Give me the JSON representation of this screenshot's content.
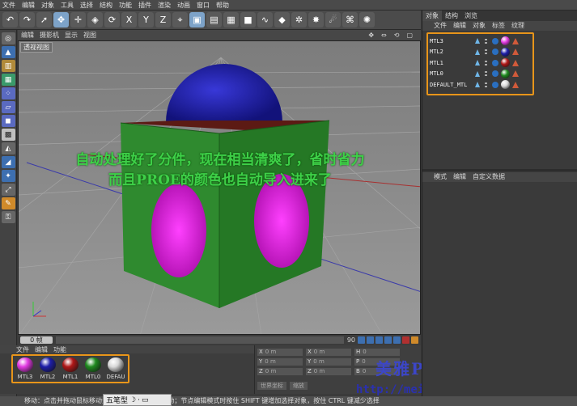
{
  "menubar": [
    "文件",
    "编辑",
    "对象",
    "工具",
    "选择",
    "结构",
    "功能",
    "插件",
    "渲染",
    "动画",
    "窗口",
    "帮助"
  ],
  "viewport": {
    "menu": [
      "编辑",
      "摄影机",
      "显示",
      "视图"
    ],
    "label": "透视视图",
    "caption_line1": "自动处理好了分件，现在相当清爽了，省时省力",
    "caption_line2": "而且PROE的颜色也自动导入进来了"
  },
  "timeline": {
    "frame_left": "0 帧",
    "frame_right": "90"
  },
  "materials": {
    "menu": [
      "文件",
      "编辑",
      "功能"
    ],
    "items": [
      {
        "name": "MTL3",
        "color": "#e23ae2"
      },
      {
        "name": "MTL2",
        "color": "#1e1ea8"
      },
      {
        "name": "MTL1",
        "color": "#b01818"
      },
      {
        "name": "MTL0",
        "color": "#1f8a1f"
      },
      {
        "name": "DEFAU",
        "color": "#d8d8d8"
      }
    ]
  },
  "coords": {
    "rows": [
      [
        {
          "axis": "X",
          "val": "0 m"
        },
        {
          "axis": "X",
          "val": "0 m"
        },
        {
          "axis": "H",
          "val": "0"
        }
      ],
      [
        {
          "axis": "Y",
          "val": "0 m"
        },
        {
          "axis": "Y",
          "val": "0 m"
        },
        {
          "axis": "P",
          "val": "0"
        }
      ],
      [
        {
          "axis": "Z",
          "val": "0 m"
        },
        {
          "axis": "Z",
          "val": "0 m"
        },
        {
          "axis": "B",
          "val": "0"
        }
      ]
    ],
    "mode": "世界坐标",
    "scale": "缩放"
  },
  "objects": {
    "tabs": [
      "对象",
      "结构",
      "浏览"
    ],
    "menu": [
      "文件",
      "编辑",
      "对象",
      "标签",
      "纹理"
    ],
    "rows": [
      {
        "name": "MTL3",
        "color": "#e23ae2"
      },
      {
        "name": "MTL2",
        "color": "#1e1ea8"
      },
      {
        "name": "MTL1",
        "color": "#b01818"
      },
      {
        "name": "MTL0",
        "color": "#1f8a1f"
      },
      {
        "name": "DEFAULT_MTL",
        "color": "#d8d8d8"
      }
    ]
  },
  "attributes": {
    "menu": [
      "模式",
      "编辑",
      "自定义数据"
    ]
  },
  "statusbar": {
    "text": "移动：点击并拖动鼠标移动元素，SHIFT 键量化移动；节点编辑模式时按住 SHIFT 键增加选择对象，按住 CTRL 键减少选择"
  },
  "ime": {
    "label": "五笔型"
  },
  "watermark": {
    "title": "美雅Pro/E中文论坛",
    "url": "http://meiya.tech.topzj.com"
  }
}
